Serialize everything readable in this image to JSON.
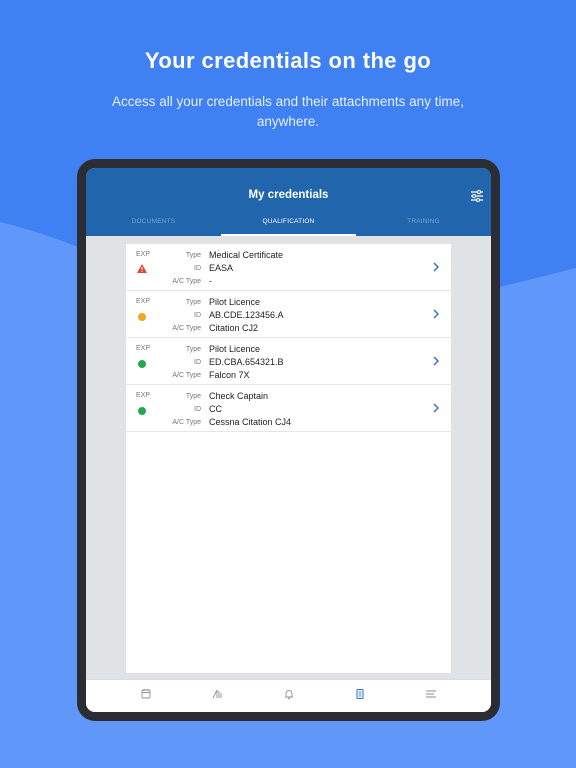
{
  "promo": {
    "headline": "Your credentials on the go",
    "subline": "Access all your credentials and their attachments any time, anywhere."
  },
  "colors": {
    "background": "#3f80f2",
    "appbar": "#2165ac",
    "accent_chevron": "#2f6fc2",
    "status_orange": "#f2a623",
    "status_green": "#27a74d",
    "status_warning": "#e0443b"
  },
  "app": {
    "title": "My credentials",
    "filter_icon": "sliders-icon",
    "tabs": [
      {
        "label": "DOCUMENTS",
        "active": false
      },
      {
        "label": "QUALIFICATION",
        "active": true
      },
      {
        "label": "TRAINING",
        "active": false
      }
    ]
  },
  "labels": {
    "exp": "EXP",
    "type": "Type",
    "id": "ID",
    "ac_type": "A/C Type"
  },
  "credentials": [
    {
      "status": "warning",
      "status_icon": "warning-triangle-icon",
      "type": "Medical Certificate",
      "id": "EASA",
      "ac_type": "-"
    },
    {
      "status": "orange",
      "status_icon": "status-dot-icon",
      "type": "Pilot Licence",
      "id": "AB.CDE.123456.A",
      "ac_type": "Citation CJ2"
    },
    {
      "status": "green",
      "status_icon": "status-dot-icon",
      "type": "Pilot Licence",
      "id": "ED.CBA.654321.B",
      "ac_type": "Falcon 7X"
    },
    {
      "status": "green",
      "status_icon": "status-dot-icon",
      "type": "Check Captain",
      "id": "CC",
      "ac_type": "Cessna Citation CJ4"
    }
  ],
  "bottom_nav": [
    {
      "icon": "calendar-icon",
      "active": false
    },
    {
      "icon": "flight-log-icon",
      "active": false
    },
    {
      "icon": "bell-icon",
      "active": false
    },
    {
      "icon": "credentials-icon",
      "active": true
    },
    {
      "icon": "menu-icon",
      "active": false
    }
  ]
}
